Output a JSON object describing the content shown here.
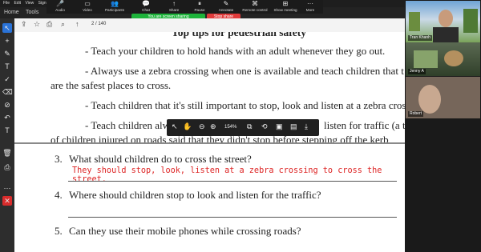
{
  "menu": [
    "File",
    "Edit",
    "View",
    "Sign"
  ],
  "app": {
    "home": "Home",
    "tools": "Tools"
  },
  "zoom_bar": {
    "items": [
      {
        "label": "Audio",
        "icon": "🎤"
      },
      {
        "label": "Video",
        "icon": "▭"
      },
      {
        "label": "Participants",
        "icon": "👥"
      },
      {
        "label": "Chat",
        "icon": "💬"
      },
      {
        "label": "Share",
        "icon": "↑"
      },
      {
        "label": "Pause",
        "icon": "⏸"
      },
      {
        "label": "Annotate",
        "icon": "✎"
      },
      {
        "label": "Remote control",
        "icon": "⌘"
      },
      {
        "label": "Show meeting",
        "icon": "⊞"
      },
      {
        "label": "More",
        "icon": "···"
      }
    ],
    "sharing_text": "You are screen sharing",
    "stop_text": "Stop share"
  },
  "pdf_toolbar": {
    "page_current": "2",
    "page_total": "140",
    "page_display": "2 / 140"
  },
  "float_toolbar": {
    "zoom": "154%"
  },
  "document": {
    "heading": "Top tips for pedestrian safety",
    "lines": [
      "- Teach your children to hold hands with an adult whenever they go out.",
      "- Always use a zebra crossing when one is available and teach children that t",
      "are the safest places to cross.",
      "- Teach children that it's still important to stop, look and listen at a zebra cross",
      "- Teach children alw",
      "listen for traffic (a third",
      "of children injured on roads said that they didn't stop before stepping off the kerb"
    ],
    "questions": [
      {
        "num": "3.",
        "text": "What should children do to cross the street?"
      },
      {
        "num": "4.",
        "text": "Where should children stop to look and listen for the traffic?"
      },
      {
        "num": "5.",
        "text": "Can they use their mobile phones while crossing roads?"
      }
    ],
    "answer_q3": "They should stop, look, listen at a zebra crossing to cross the street."
  },
  "participants": [
    {
      "name": "Tran Khanh"
    },
    {
      "name": "Jenny A"
    },
    {
      "name": "Robert"
    }
  ],
  "colors": {
    "share_green": "#1db33a",
    "stop_red": "#e03a3a",
    "answer_red": "#d22222",
    "zoom_dark": "#1b1b1b"
  }
}
